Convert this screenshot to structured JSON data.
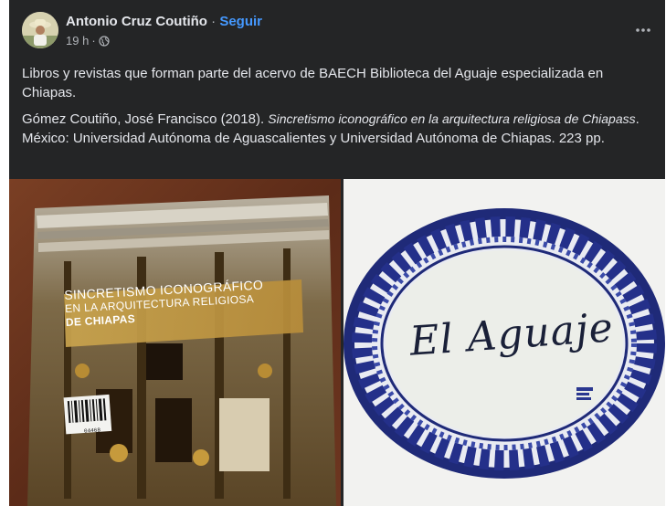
{
  "post": {
    "author": "Antonio Cruz Coutiño",
    "separator": "·",
    "follow_label": "Seguir",
    "time": "19 h",
    "time_separator": "·",
    "privacy_icon": "globe-icon",
    "more_icon": "more-horizontal-icon",
    "text_line1": "Libros y revistas que forman parte del acervo de BAECH Biblioteca del Aguaje especializada en Chiapas.",
    "citation_prefix": "Gómez Coutiño, José Francisco (2018). ",
    "citation_title": "Sincretismo iconográfico en la arquitectura religiosa de Chiapass",
    "citation_suffix": ". México: Universidad Autónoma de Aguascalientes y Universidad Autónoma de Chiapas. 223 pp."
  },
  "photos": {
    "book_cover": {
      "line1": "SINCRETISMO ICONOGRÁFICO",
      "line2": "EN LA ARQUITECTURA RELIGIOSA",
      "line3": "DE CHIAPAS",
      "barcode_number": "04468"
    },
    "sign": {
      "text": "El Aguaje"
    }
  },
  "colors": {
    "card_bg": "#242526",
    "text_primary": "#e4e6eb",
    "text_secondary": "#b0b3b8",
    "link_blue": "#4599ff"
  }
}
